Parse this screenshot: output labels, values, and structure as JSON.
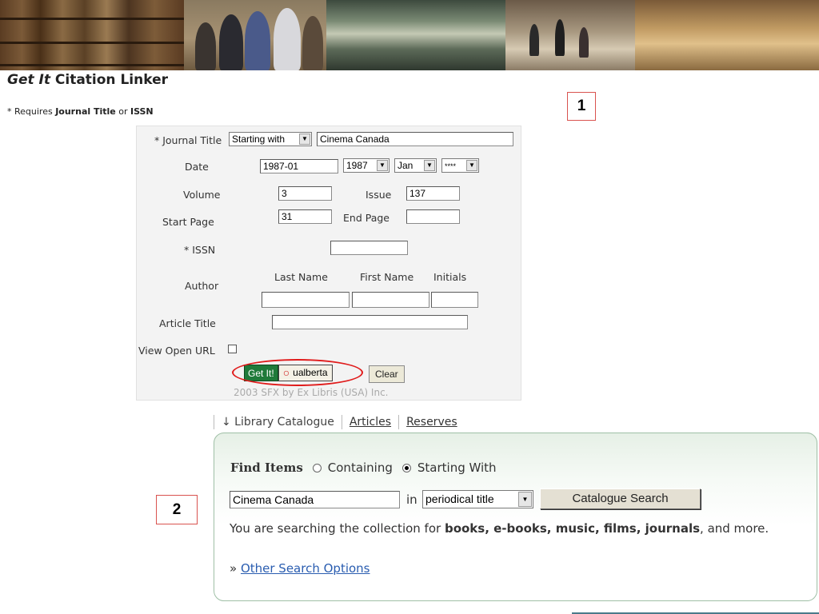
{
  "header": {
    "title_italic": "Get It",
    "title_rest": " Citation Linker",
    "requires_prefix": "* Requires ",
    "requires_journal": "Journal Title",
    "requires_or": " or ",
    "requires_issn": "ISSN"
  },
  "callouts": {
    "one": "1",
    "two": "2"
  },
  "citation_form": {
    "journal_title_label": "* Journal Title",
    "journal_match_select": "Starting with",
    "journal_title_value": "Cinema Canada",
    "date_label": "Date",
    "date_value": "1987-01",
    "year_select": "1987",
    "month_select": "Jan",
    "day_select": "****",
    "volume_label": "Volume",
    "volume_value": "3",
    "issue_label": "Issue",
    "issue_value": "137",
    "start_page_label": "Start Page",
    "start_page_value": "31",
    "end_page_label": "End Page",
    "end_page_value": "",
    "issn_label": "* ISSN",
    "issn_value": "",
    "author_label": "Author",
    "last_name_label": "Last Name",
    "first_name_label": "First Name",
    "initials_label": "Initials",
    "article_title_label": "Article Title",
    "article_title_value": "",
    "view_open_url_label": "View Open URL",
    "getit_label": "Get It!",
    "ualberta_label": "ualberta",
    "clear_label": "Clear",
    "copyright": "2003 SFX by Ex Libris (USA) Inc."
  },
  "search": {
    "tab_library": "↓ Library Catalogue",
    "tab_articles": "Articles",
    "tab_reserves": "Reserves",
    "find_items_label": "Find Items",
    "containing_label": "Containing",
    "starting_with_label": "Starting With",
    "query_value": "Cinema Canada",
    "in_label": "in",
    "field_select": "periodical title",
    "catalogue_button": "Catalogue Search",
    "desc_prefix": "You are searching the collection for ",
    "desc_bold": "books, e-books, music, films, journals",
    "desc_suffix": ", and more.",
    "other_prefix": "» ",
    "other_link": "Other Search Options"
  },
  "colors": {
    "accent_red": "#e01b1b",
    "getit_green": "#1f7a3a",
    "link_blue": "#2a5db0",
    "search_border": "#9fbfa6"
  }
}
